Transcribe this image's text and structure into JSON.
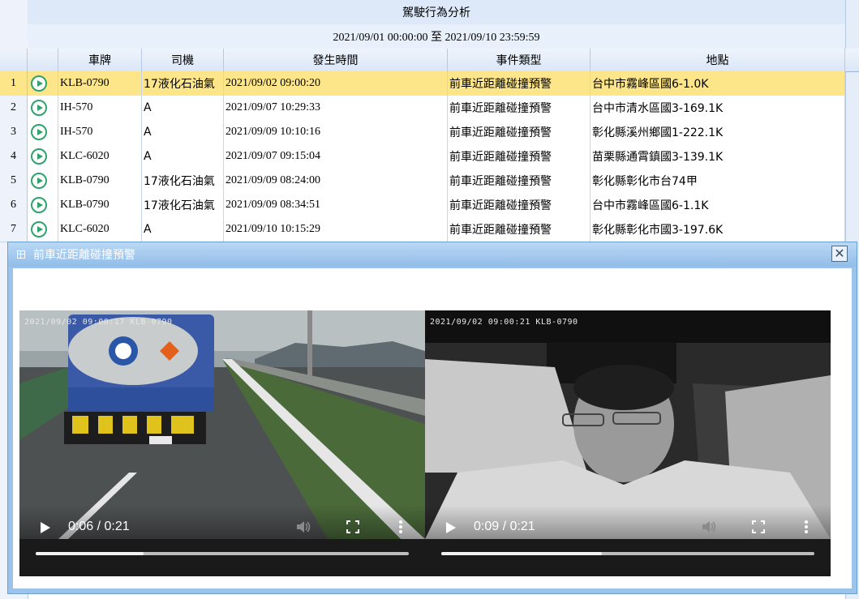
{
  "report": {
    "title": "駕駛行為分析",
    "date_range": "2021/09/01 00:00:00 至 2021/09/10 23:59:59"
  },
  "columns": [
    "車牌",
    "司機",
    "發生時間",
    "事件類型",
    "地點"
  ],
  "rows": [
    {
      "num": "1",
      "plate": "KLB-0790",
      "driver": "17液化石油氣",
      "time": "2021/09/02 09:00:20",
      "event": "前車近距離碰撞預警",
      "location": "台中市霧峰區國6-1.0K"
    },
    {
      "num": "2",
      "plate": "IH-570",
      "driver": "A",
      "time": "2021/09/07 10:29:33",
      "event": "前車近距離碰撞預警",
      "location": "台中市清水區國3-169.1K"
    },
    {
      "num": "3",
      "plate": "IH-570",
      "driver": "A",
      "time": "2021/09/09 10:10:16",
      "event": "前車近距離碰撞預警",
      "location": "彰化縣溪州鄉國1-222.1K"
    },
    {
      "num": "4",
      "plate": "KLC-6020",
      "driver": "A",
      "time": "2021/09/07 09:15:04",
      "event": "前車近距離碰撞預警",
      "location": "苗栗縣通霄鎮國3-139.1K"
    },
    {
      "num": "5",
      "plate": "KLB-0790",
      "driver": "17液化石油氣",
      "time": "2021/09/09 08:24:00",
      "event": "前車近距離碰撞預警",
      "location": "彰化縣彰化市台74甲"
    },
    {
      "num": "6",
      "plate": "KLB-0790",
      "driver": "17液化石油氣",
      "time": "2021/09/09 08:34:51",
      "event": "前車近距離碰撞預警",
      "location": "台中市霧峰區國6-1.1K"
    },
    {
      "num": "7",
      "plate": "KLC-6020",
      "driver": "A",
      "time": "2021/09/10 10:15:29",
      "event": "前車近距離碰撞預警",
      "location": "彰化縣彰化市國3-197.6K"
    }
  ],
  "selected_row": 1,
  "dialog": {
    "title": "前車近距離碰撞預警",
    "close_glyph": "✕"
  },
  "videos": [
    {
      "name": "front-camera",
      "osd": "2021/09/02 09:00:17 KLB-0790",
      "time_label": "0:06 / 0:21",
      "progress": 0.29
    },
    {
      "name": "cabin-camera",
      "osd": "2021/09/02 09:00:21 KLB-0790",
      "time_label": "0:09 / 0:21",
      "progress": 0.43
    }
  ],
  "colors": {
    "selected_row": "#fde68a",
    "play_icon": "#2ea36a",
    "dialog_header": "#9cc4ea"
  },
  "icons": {
    "row_play": "circle-play-icon",
    "dialog": "window-grid-icon",
    "close": "close-icon"
  }
}
